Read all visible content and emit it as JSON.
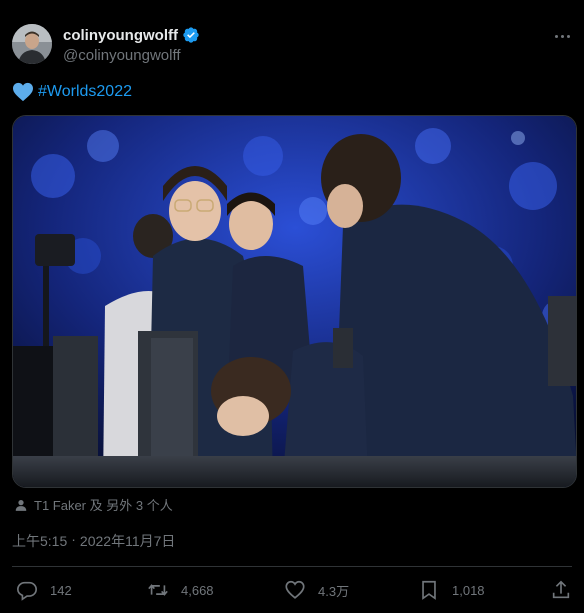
{
  "author": {
    "display_name": "colinyoungwolff",
    "handle": "@colinyoungwolff",
    "verified": true
  },
  "tweet": {
    "hashtag": "#Worlds2022",
    "emoji": "blue-heart"
  },
  "tagged": {
    "text": "T1 Faker 及 另外 3 个人"
  },
  "timestamp": {
    "time": "上午5:15",
    "separator": "·",
    "date": "2022年11月7日"
  },
  "actions": {
    "replies": "142",
    "retweets": "4,668",
    "likes": "4.3万",
    "bookmarks": "1,018"
  },
  "colors": {
    "accent": "#1d9bf0",
    "secondary_text": "#71767b",
    "divider": "#2f3336"
  }
}
